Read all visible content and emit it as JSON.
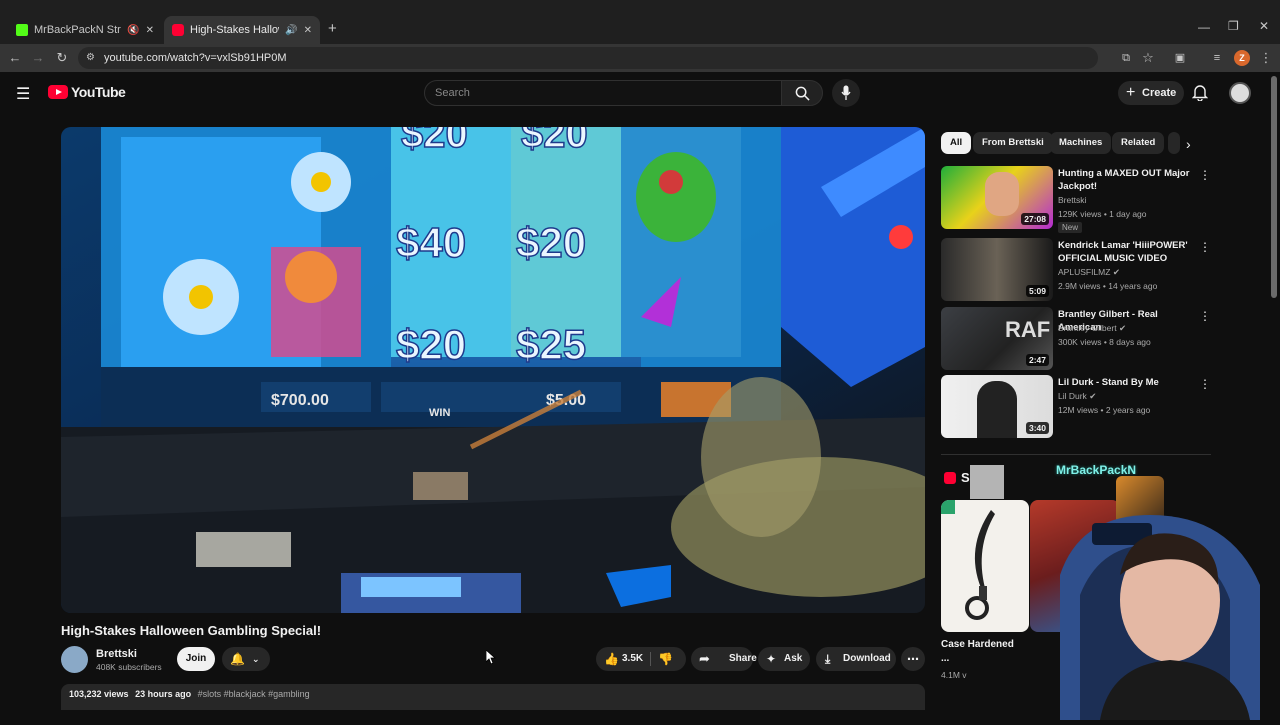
{
  "browser": {
    "tabs": [
      {
        "title": "MrBackPackN Stream - Wat",
        "active": false,
        "favicon_color": "#53fc18"
      },
      {
        "title": "High-Stakes Halloween Gam",
        "active": true,
        "favicon_color": "#ff0033"
      }
    ],
    "url": "youtube.com/watch?v=vxlSb91HP0M",
    "profile_initial": "Z"
  },
  "youtube": {
    "logo_text": "YouTube",
    "search_placeholder": "Search",
    "create_label": "Create"
  },
  "video": {
    "title": "High-Stakes Halloween Gambling Special!",
    "channel": "Brettski",
    "subscribers": "408K subscribers",
    "join_label": "Join",
    "likes": "3.5K",
    "share_label": "Share",
    "ask_label": "Ask",
    "download_label": "Download",
    "views": "103,232 views",
    "age": "23 hours ago",
    "hashtags": "#slots #blackjack #gambling",
    "screen_text": {
      "prize1": "$20",
      "prize2": "$20",
      "prize3": "$40",
      "prize4": "$20",
      "prize5": "$20",
      "prize6": "$25",
      "balance": "$700.00",
      "win_label": "WIN",
      "bet": "$5.00"
    }
  },
  "sidebar": {
    "chips": [
      "All",
      "From Brettski",
      "Machines",
      "Related"
    ],
    "recommendations": [
      {
        "title": "Hunting a MAXED OUT Major Jackpot!",
        "channel": "Brettski",
        "meta": "129K views • 1 day ago",
        "duration": "27:08",
        "badge": "New",
        "verified": false
      },
      {
        "title": "Kendrick Lamar 'HiiiPOWER' OFFICIAL MUSIC VIDEO",
        "channel": "APLUSFILMZ",
        "meta": "2.9M views • 14 years ago",
        "duration": "5:09",
        "verified": true
      },
      {
        "title": "Brantley Gilbert - Real American",
        "channel": "Brantley Gilbert",
        "meta": "300K views • 8 days ago",
        "duration": "2:47",
        "verified": true
      },
      {
        "title": "Lil Durk - Stand By Me",
        "channel": "Lil Durk",
        "meta": "12M views • 2 years ago",
        "duration": "3:40",
        "verified": true
      }
    ],
    "shorts_label": "S",
    "short_item": {
      "title": "Case Hardened ...",
      "views": "4.1M v"
    },
    "overlay_label": "MrBackPackN"
  },
  "colors": {
    "brand_red": "#ff0033",
    "background": "#0f0f0f",
    "surface": "#272727"
  }
}
